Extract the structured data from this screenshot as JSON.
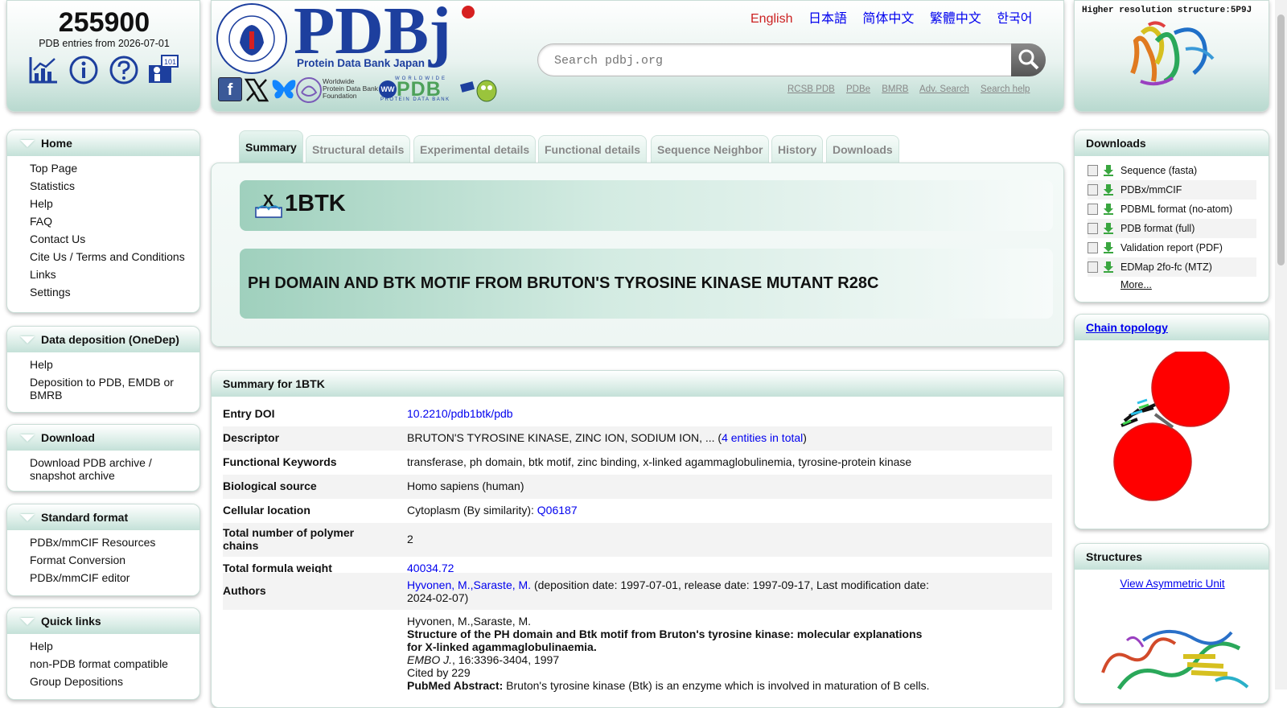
{
  "stats": {
    "count": "255900",
    "caption": "PDB entries from 2026-07-01"
  },
  "header": {
    "logo_text": "PDBj",
    "logo_sub": "Protein Data Bank Japan",
    "seal_text": "PROTEIN DATA BANK JAPAN · THE UNIVERSITY OF OSAKA",
    "foundation_line1": "Worldwide",
    "foundation_line2": "Protein Data Bank",
    "foundation_line3": "Foundation",
    "wwpdb_text": "PDB",
    "wwpdb_top": "WORLDWIDE",
    "wwpdb_bottom": "PROTEIN DATA BANK",
    "languages": [
      "English",
      "日本語",
      "简体中文",
      "繁體中文",
      "한국어"
    ],
    "search_placeholder": "Search pdbj.org",
    "links": [
      "RCSB PDB",
      "PDBe",
      "BMRB",
      "Adv. Search",
      "Search help"
    ]
  },
  "featured": {
    "title": "Higher resolution structure:5P9J"
  },
  "sidebar": {
    "sections": [
      {
        "title": "Home",
        "items": [
          "Top Page",
          "Statistics",
          "Help",
          "FAQ",
          "Contact Us",
          "Cite Us / Terms and Conditions",
          "Links",
          "Settings"
        ]
      },
      {
        "title": "Data deposition (OneDep)",
        "items": [
          "Help",
          "Deposition to PDB, EMDB or BMRB"
        ]
      },
      {
        "title": "Download",
        "items": [
          "Download PDB archive / snapshot archive"
        ]
      },
      {
        "title": "Standard format",
        "items": [
          "PDBx/mmCIF Resources",
          "Format Conversion",
          "PDBx/mmCIF editor"
        ]
      },
      {
        "title": "Quick links",
        "items": [
          "Help",
          "non-PDB format compatible",
          "Group Depositions"
        ]
      }
    ]
  },
  "tabs": [
    "Summary",
    "Structural details",
    "Experimental details",
    "Functional details",
    "Sequence Neighbor",
    "History",
    "Downloads"
  ],
  "entry": {
    "id": "1BTK",
    "title": "PH DOMAIN AND BTK MOTIF FROM BRUTON'S TYROSINE KINASE MUTANT R28C",
    "badge_letter": "X"
  },
  "summary": {
    "heading": "Summary for 1BTK",
    "doi_label": "Entry DOI",
    "doi": "10.2210/pdb1btk/pdb",
    "descriptor_label": "Descriptor",
    "descriptor": "BRUTON'S TYROSINE KINASE, ZINC ION, SODIUM ION, ... (",
    "descriptor_link": "4 entities in total",
    "descriptor_close": ")",
    "keywords_label": "Functional Keywords",
    "keywords": "transferase, ph domain, btk motif, zinc binding, x-linked agammaglobulinemia, tyrosine-protein kinase",
    "source_label": "Biological source",
    "source": "Homo sapiens (human)",
    "location_label": "Cellular location",
    "location": "Cytoplasm (By similarity): ",
    "location_link": "Q06187",
    "chains_label": "Total number of polymer chains",
    "chains": "2",
    "weight_label": "Total formula weight",
    "weight": "40034.72",
    "authors_label": "Authors",
    "authors_link": "Hyvonen, M.,Saraste, M.",
    "authors_dates": " (deposition date: 1997-07-01, release date: 1997-09-17, Last modification date: 2024-02-07)",
    "citation_authors": "Hyvonen, M.,Saraste, M.",
    "citation_title": "Structure of the PH domain and Btk motif from Bruton's tyrosine kinase: molecular explanations for X-linked agammaglobulinaemia.",
    "citation_journal": "EMBO J.",
    "citation_rest": ", 16:3396-3404, 1997",
    "cited_by": "Cited by 229",
    "abstract_label": "PubMed Abstract:",
    "abstract_text": " Bruton's tyrosine kinase (Btk) is an enzyme which is involved in maturation of B cells."
  },
  "downloads": {
    "title": "Downloads",
    "items": [
      "Sequence (fasta)",
      "PDBx/mmCIF",
      "PDBML format (no-atom)",
      "PDB format (full)",
      "Validation report (PDF)",
      "EDMap 2fo-fc (MTZ)"
    ],
    "more": "More..."
  },
  "topology": {
    "title": "Chain topology"
  },
  "structures": {
    "title": "Structures",
    "link": "View Asymmetric Unit"
  },
  "colors": {
    "accent": "#b8d9cf",
    "link": "#0000ee",
    "lang_active": "#cc2222",
    "logo_blue": "#1d3f9e"
  }
}
